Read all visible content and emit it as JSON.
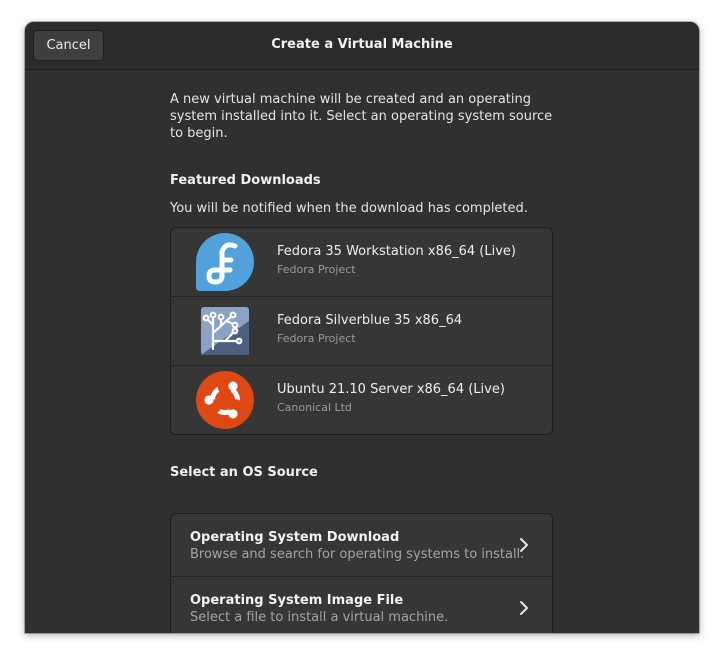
{
  "header": {
    "cancel_label": "Cancel",
    "title": "Create a Virtual Machine"
  },
  "intro_text": "A new virtual machine will be created and an operating system installed into it. Select an operating system source to begin.",
  "featured": {
    "title": "Featured Downloads",
    "note": "You will be notified when the download has completed.",
    "items": [
      {
        "name": "Fedora 35 Workstation x86_64 (Live)",
        "vendor": "Fedora Project",
        "icon": "fedora-logo-icon"
      },
      {
        "name": "Fedora Silverblue 35 x86_64",
        "vendor": "Fedora Project",
        "icon": "silverblue-logo-icon"
      },
      {
        "name": "Ubuntu 21.10 Server x86_64 (Live)",
        "vendor": "Canonical Ltd",
        "icon": "ubuntu-logo-icon"
      }
    ]
  },
  "sources": {
    "title": "Select an OS Source",
    "items": [
      {
        "title": "Operating System Download",
        "subtitle": "Browse and search for operating systems to install.",
        "icon": "chevron-right-icon"
      },
      {
        "title": "Operating System Image File",
        "subtitle": "Select a file to install a virtual machine.",
        "icon": "chevron-right-icon"
      }
    ]
  },
  "colors": {
    "window_bg": "#303030",
    "headerbar_bg": "#2b2b2b",
    "list_bg": "#363636",
    "fedora_blue": "#3c6eb4",
    "fedora_light_blue": "#51a2da",
    "silverblue_slate": "#5b6f8f",
    "ubuntu_orange": "#dd4814"
  }
}
